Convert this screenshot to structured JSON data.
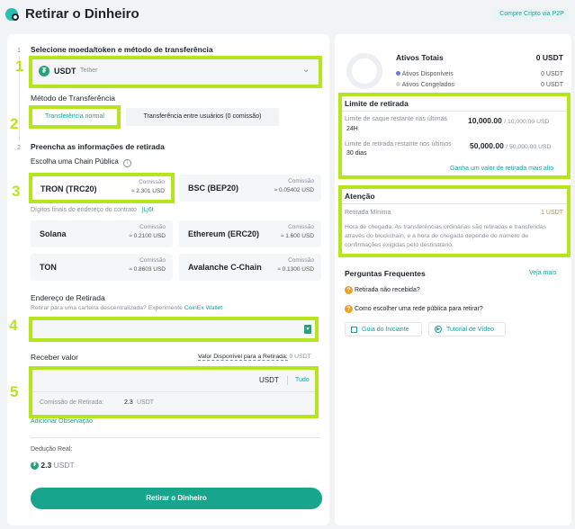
{
  "header": {
    "title": "Retirar o Dinheiro",
    "p2p_link": "Compre Cripto via P2P"
  },
  "steps": [
    "1",
    "2",
    "3",
    "4",
    "5"
  ],
  "section1": {
    "number": "1",
    "title": "Selecione moeda/token e método de transferência",
    "coin": {
      "symbol": "USDT",
      "name": "Tether"
    },
    "method_label": "Método de Transferência",
    "methods": [
      "Transferência normal",
      "Transferência entre usuários (0 comissão)"
    ]
  },
  "section2": {
    "number": "2",
    "title": "Preencha as informações de retirada",
    "chain_label": "Escolha uma Chain Pública",
    "chains": [
      {
        "name": "TRON (TRC20)",
        "fee_label": "Comissão",
        "fee": "≈ 2.301 USD"
      },
      {
        "name": "BSC (BEP20)",
        "fee_label": "Comissão",
        "fee": "≈ 0.05402 USD"
      },
      {
        "name": "Solana",
        "fee_label": "Comissão",
        "fee": "≈ 0.2100 USD"
      },
      {
        "name": "Ethereum (ERC20)",
        "fee_label": "Comissão",
        "fee": "≈ 1.600 USD"
      },
      {
        "name": "TON",
        "fee_label": "Comissão",
        "fee": "≈ 0.8603 USD"
      },
      {
        "name": "Avalanche C-Chain",
        "fee_label": "Comissão",
        "fee": "≈ 0.1300 USD"
      }
    ],
    "address_digits_hint": "Dígitos finais do endereço do contrato",
    "address_digits_value": "jLj6t",
    "address_label": "Endereço de Retirada",
    "address_hint": "Retirar para uma carteira descentralizada? Experimente",
    "address_hint_link": "CoinEx Wallet",
    "receive_label": "Receber valor",
    "available_label": "Valor Disponível para a Retirada:",
    "available_value": "0 USDT",
    "amount_unit": "USDT",
    "all_label": "Tudo",
    "fee_label": "Comissão de Retirada:",
    "fee_value": "2.3",
    "fee_unit": "USDT",
    "add_note": "Adicionar Observação",
    "deduction_label": "Dedução Real:",
    "deduction_value": "2.3",
    "deduction_unit": "USDT",
    "submit": "Retirar o Dinheiro"
  },
  "assets": {
    "title": "Ativos Totais",
    "total": "0 USDT",
    "rows": [
      {
        "label": "Ativos Disponíveis",
        "value": "0 USDT",
        "color": "#6c7bd9"
      },
      {
        "label": "Ativos Congelados",
        "value": "0 USDT",
        "color": "#d3d6db"
      }
    ]
  },
  "limits": {
    "title": "Limite de retirada",
    "rows": [
      {
        "label": "Limite de saque restante nas últimas",
        "period": "24H",
        "value": "10,000.00",
        "max": "/ 10,000.00 USD"
      },
      {
        "label": "Limite de retirada restante nos últimos",
        "period": "30 dias",
        "value": "50,000.00",
        "max": "/ 50,000.00 USD"
      }
    ],
    "link": "Ganha um valor de retirada mais alto"
  },
  "attention": {
    "title": "Atenção",
    "min_label": "Retirada Mínima",
    "min_value": "1 USDT",
    "note": "Hora de chegada:  As transferências ordinárias são retiradas e transferidas através do blockchain, e a hora de chegada depende do número de confirmações exigidas pelo destinatário."
  },
  "faq": {
    "title": "Perguntas Frequentes",
    "more": "Veja mais",
    "items": [
      "Retirada não recebida?",
      "Como escolher uma rede pública para retirar?"
    ],
    "buttons": [
      "Guia do Iniciante",
      "Tutorial de Vídeo"
    ]
  },
  "colors": {
    "accent": "#17a0a0",
    "highlight": "#b5e61d",
    "tether": "#26a17b"
  }
}
